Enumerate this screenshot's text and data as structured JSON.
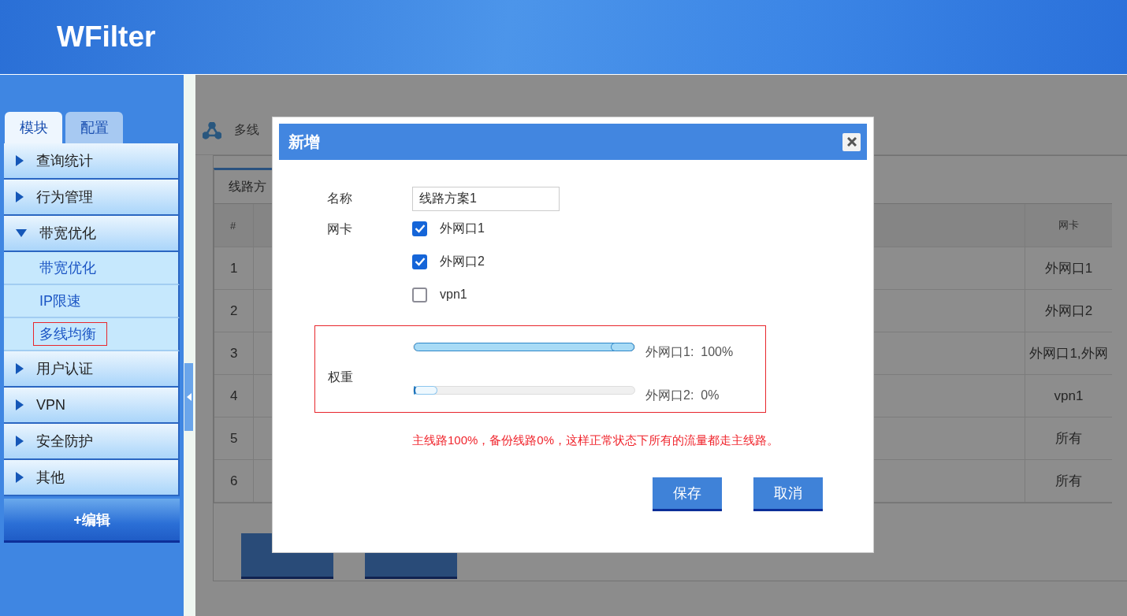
{
  "header": {
    "logo": "WFilter"
  },
  "sidebar": {
    "tabs": [
      {
        "label": "模块",
        "selected": true
      },
      {
        "label": "配置",
        "selected": false
      }
    ],
    "menu": [
      {
        "label": "查询统计",
        "expanded": false
      },
      {
        "label": "行为管理",
        "expanded": false
      },
      {
        "label": "带宽优化",
        "expanded": true,
        "children": [
          {
            "label": "带宽优化",
            "selected": false
          },
          {
            "label": "IP限速",
            "selected": false
          },
          {
            "label": "多线均衡",
            "selected": true
          }
        ]
      },
      {
        "label": "用户认证",
        "expanded": false
      },
      {
        "label": "VPN",
        "expanded": false
      },
      {
        "label": "安全防护",
        "expanded": false
      },
      {
        "label": "其他",
        "expanded": false
      }
    ],
    "edit_button": "+编辑"
  },
  "page": {
    "title": "多线",
    "tabs": [
      {
        "label": "线路方",
        "selected": true
      }
    ],
    "table": {
      "columns": [
        {
          "label": "#"
        },
        {},
        {
          "label": "网卡"
        }
      ],
      "rows": [
        {
          "index": "1",
          "nic": "外网口1"
        },
        {
          "index": "2",
          "nic": "外网口2"
        },
        {
          "index": "3",
          "nic": "外网口1,外网"
        },
        {
          "index": "4",
          "nic": "vpn1"
        },
        {
          "index": "5",
          "nic": "所有"
        },
        {
          "index": "6",
          "nic": "所有"
        }
      ]
    },
    "footer_buttons": [
      {
        "kind": "button"
      },
      {
        "kind": "button"
      }
    ]
  },
  "dialog": {
    "title": "新增",
    "name_label": "名称",
    "name_value": "线路方案1",
    "nic_label": "网卡",
    "nics": [
      {
        "label": "外网口1",
        "checked": true
      },
      {
        "label": "外网口2",
        "checked": true
      },
      {
        "label": "vpn1",
        "checked": false
      }
    ],
    "weight_label": "权重",
    "weights": [
      {
        "label": "外网口1:  100%",
        "level": 1
      },
      {
        "label": "外网口2:  0%",
        "level": 0
      }
    ],
    "note": "主线路100%，备份线路0%，这样正常状态下所有的流量都走主线路。",
    "buttons": [
      "保存",
      "取消"
    ]
  }
}
